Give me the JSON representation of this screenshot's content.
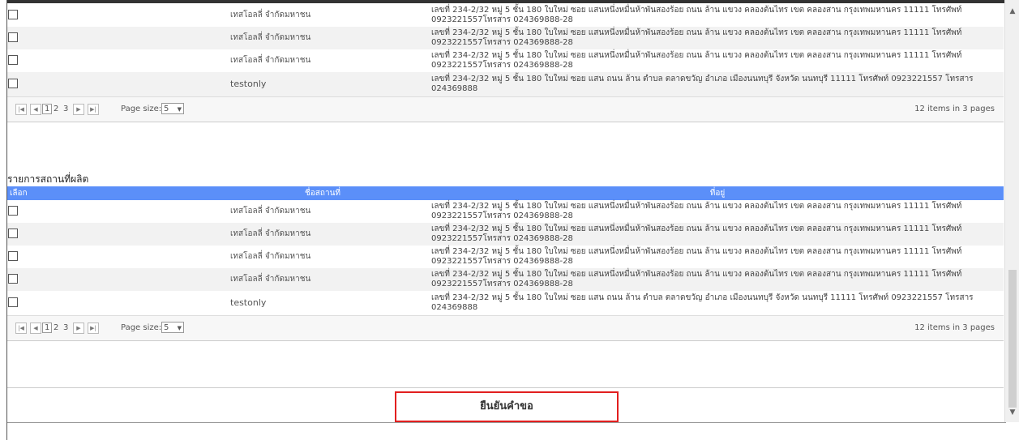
{
  "grid1": {
    "rows": [
      {
        "name": "เทสโอลลี่ จำกัดมหาชน",
        "addr": "เลขที่ 234-2/32 หมู่ 5 ชั้น 180 ใบใหม่ ซอย แสนหนึ่งหมื่นห้าพันสองร้อย ถนน ล้าน แขวง คลองต้นไทร เขต คลองสาน กรุงเทพมหานคร 11111 โทรศัพท์ 0923221557โทรสาร 024369888-28"
      },
      {
        "name": "เทสโอลลี่ จำกัดมหาชน",
        "addr": "เลขที่ 234-2/32 หมู่ 5 ชั้น 180 ใบใหม่ ซอย แสนหนึ่งหมื่นห้าพันสองร้อย ถนน ล้าน แขวง คลองต้นไทร เขต คลองสาน กรุงเทพมหานคร 11111 โทรศัพท์ 0923221557โทรสาร 024369888-28"
      },
      {
        "name": "เทสโอลลี่ จำกัดมหาชน",
        "addr": "เลขที่ 234-2/32 หมู่ 5 ชั้น 180 ใบใหม่ ซอย แสนหนึ่งหมื่นห้าพันสองร้อย ถนน ล้าน แขวง คลองต้นไทร เขต คลองสาน กรุงเทพมหานคร 11111 โทรศัพท์ 0923221557โทรสาร 024369888-28"
      },
      {
        "name": "testonly",
        "addr": "เลขที่ 234-2/32 หมู่ 5 ชั้น 180 ใบใหม่ ซอย แสน ถนน ล้าน ตำบล ตลาดขวัญ อำเภอ เมืองนนทบุรี จังหวัด นนทบุรี 11111 โทรศัพท์ 0923221557 โทรสาร 024369888"
      }
    ],
    "pager": {
      "pages": [
        "1",
        "2",
        "3"
      ],
      "page_size_label": "Page size:",
      "page_size": "5",
      "info": "12 items in 3 pages"
    }
  },
  "grid2": {
    "title": "รายการสถานที่ผลิต",
    "headers": {
      "select": "เลือก",
      "name": "ชื่อสถานที่",
      "addr": "ที่อยู่"
    },
    "rows": [
      {
        "name": "เทสโอลลี่ จำกัดมหาชน",
        "addr": "เลขที่ 234-2/32 หมู่ 5 ชั้น 180 ใบใหม่ ซอย แสนหนึ่งหมื่นห้าพันสองร้อย ถนน ล้าน แขวง คลองต้นไทร เขต คลองสาน กรุงเทพมหานคร 11111 โทรศัพท์ 0923221557โทรสาร 024369888-28"
      },
      {
        "name": "เทสโอลลี่ จำกัดมหาชน",
        "addr": "เลขที่ 234-2/32 หมู่ 5 ชั้น 180 ใบใหม่ ซอย แสนหนึ่งหมื่นห้าพันสองร้อย ถนน ล้าน แขวง คลองต้นไทร เขต คลองสาน กรุงเทพมหานคร 11111 โทรศัพท์ 0923221557โทรสาร 024369888-28"
      },
      {
        "name": "เทสโอลลี่ จำกัดมหาชน",
        "addr": "เลขที่ 234-2/32 หมู่ 5 ชั้น 180 ใบใหม่ ซอย แสนหนึ่งหมื่นห้าพันสองร้อย ถนน ล้าน แขวง คลองต้นไทร เขต คลองสาน กรุงเทพมหานคร 11111 โทรศัพท์ 0923221557โทรสาร 024369888-28"
      },
      {
        "name": "เทสโอลลี่ จำกัดมหาชน",
        "addr": "เลขที่ 234-2/32 หมู่ 5 ชั้น 180 ใบใหม่ ซอย แสนหนึ่งหมื่นห้าพันสองร้อย ถนน ล้าน แขวง คลองต้นไทร เขต คลองสาน กรุงเทพมหานคร 11111 โทรศัพท์ 0923221557โทรสาร 024369888-28"
      },
      {
        "name": "testonly",
        "addr": "เลขที่ 234-2/32 หมู่ 5 ชั้น 180 ใบใหม่ ซอย แสน ถนน ล้าน ตำบล ตลาดขวัญ อำเภอ เมืองนนทบุรี จังหวัด นนทบุรี 11111 โทรศัพท์ 0923221557 โทรสาร 024369888"
      }
    ],
    "pager": {
      "pages": [
        "1",
        "2",
        "3"
      ],
      "page_size_label": "Page size:",
      "page_size": "5",
      "info": "12 items in 3 pages"
    }
  },
  "confirm_label": "ยืนยันคำขอ",
  "icons": {
    "first": "first-page-icon",
    "prev": "prev-page-icon",
    "next": "next-page-icon",
    "last": "last-page-icon",
    "dropdown": "chevron-down-icon"
  },
  "colors": {
    "header_bg": "#5b8ff9",
    "confirm_border": "#e21f1f"
  }
}
